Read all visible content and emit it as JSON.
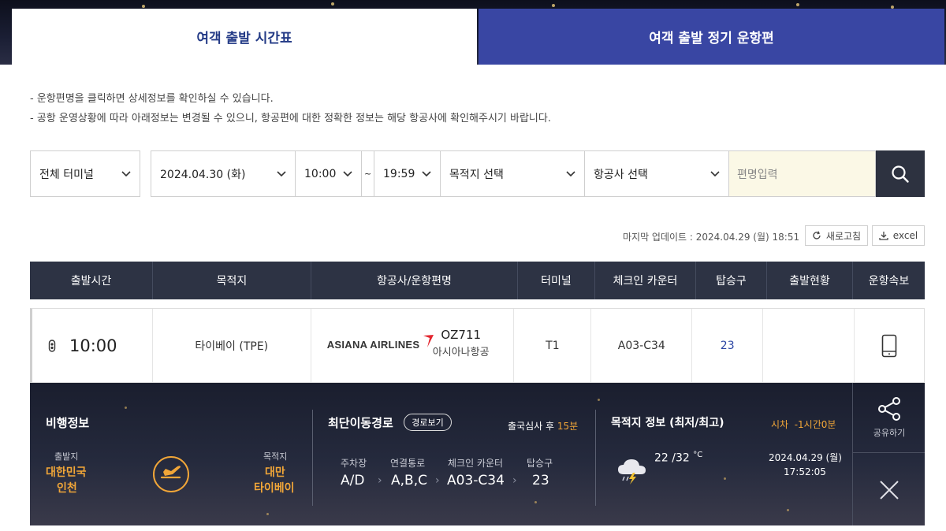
{
  "tabs": {
    "timetable": "여객 출발 시간표",
    "regular": "여객 출발 정기 운항편"
  },
  "notes": [
    "운항편명을 클릭하면 상세정보를 확인하실 수 있습니다.",
    "공항 운영상황에 따라 아래정보는 변경될 수 있으니, 항공편에 대한 정확한 정보는 해당 항공사에 확인해주시기 바랍니다."
  ],
  "filters": {
    "terminal": "전체 터미널",
    "date": "2024.04.30 (화)",
    "time_from": "10:00",
    "tilde": "~",
    "time_to": "19:59",
    "destination": "목적지 선택",
    "airline": "항공사 선택",
    "flight_placeholder": "편명입력"
  },
  "update": {
    "text": "마지막 업데이트 : 2024.04.29 (월) 18:51",
    "refresh": "새로고침",
    "excel": "excel"
  },
  "table": {
    "headers": [
      "출발시간",
      "목적지",
      "항공사/운항편명",
      "터미널",
      "체크인 카운터",
      "탑승구",
      "출발현황",
      "운항속보"
    ],
    "row": {
      "time": "10:00",
      "destination": "타이베이 (TPE)",
      "airline_logo": "ASIANA AIRLINES",
      "flight_no": "OZ711",
      "airline_name": "아시아나항공",
      "terminal": "T1",
      "checkin": "A03-C34",
      "gate": "23",
      "status": ""
    }
  },
  "detail": {
    "title": "비행정보",
    "departure_label": "출발지",
    "departure_country": "대한민국",
    "departure_city": "인천",
    "arrival_label": "목적지",
    "arrival_country": "대만",
    "arrival_city": "타이베이",
    "route_title": "최단이동경로",
    "route_button": "경로보기",
    "immigration_prefix": "출국심사 후",
    "immigration_time": "15분",
    "route_steps": [
      {
        "label": "주차장",
        "value": "A/D"
      },
      {
        "label": "연결통로",
        "value": "A,B,C"
      },
      {
        "label": "체크인 카운터",
        "value": "A03-C34"
      },
      {
        "label": "탑승구",
        "value": "23"
      }
    ],
    "weather_title": "목적지 정보 (최저/최고)",
    "time_diff": "시차  -1시간0분",
    "temp": "22 /32",
    "temp_unit": "°C",
    "local_date": "2024.04.29 (월)",
    "local_time": "17:52:05",
    "share": "공유하기"
  },
  "colors": {
    "active_tab": "#233a86",
    "inactive_tab": "#3946a3",
    "header": "#2d3344",
    "accent": "#f1a638"
  }
}
